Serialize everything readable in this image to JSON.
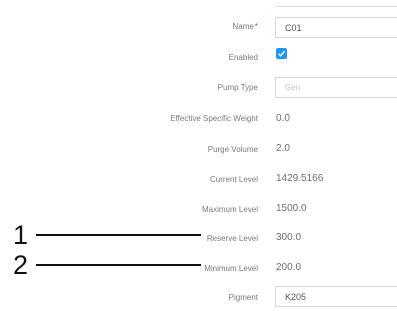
{
  "form": {
    "name_label": "Name",
    "name_required_mark": "*",
    "name_value": "C01",
    "enabled_label": "Enabled",
    "enabled_checked": true,
    "pump_type_label": "Pump Type",
    "pump_type_value": "Gen",
    "effective_specific_weight_label": "Effective Specific Weight",
    "effective_specific_weight_value": "0.0",
    "purge_volume_label": "Purge Volume",
    "purge_volume_value": "2.0",
    "current_level_label": "Current Level",
    "current_level_value": "1429.5166",
    "maximum_level_label": "Maximum Level",
    "maximum_level_value": "1500.0",
    "reserve_level_label": "Reserve Level",
    "reserve_level_value": "300.0",
    "minimum_level_label": "Minimum Level",
    "minimum_level_value": "200.0",
    "pigment_label": "Pigment",
    "pigment_value": "K205"
  },
  "callouts": {
    "one": "1",
    "two": "2"
  },
  "colors": {
    "checkbox": "#2196f3",
    "required": "#e53935"
  }
}
